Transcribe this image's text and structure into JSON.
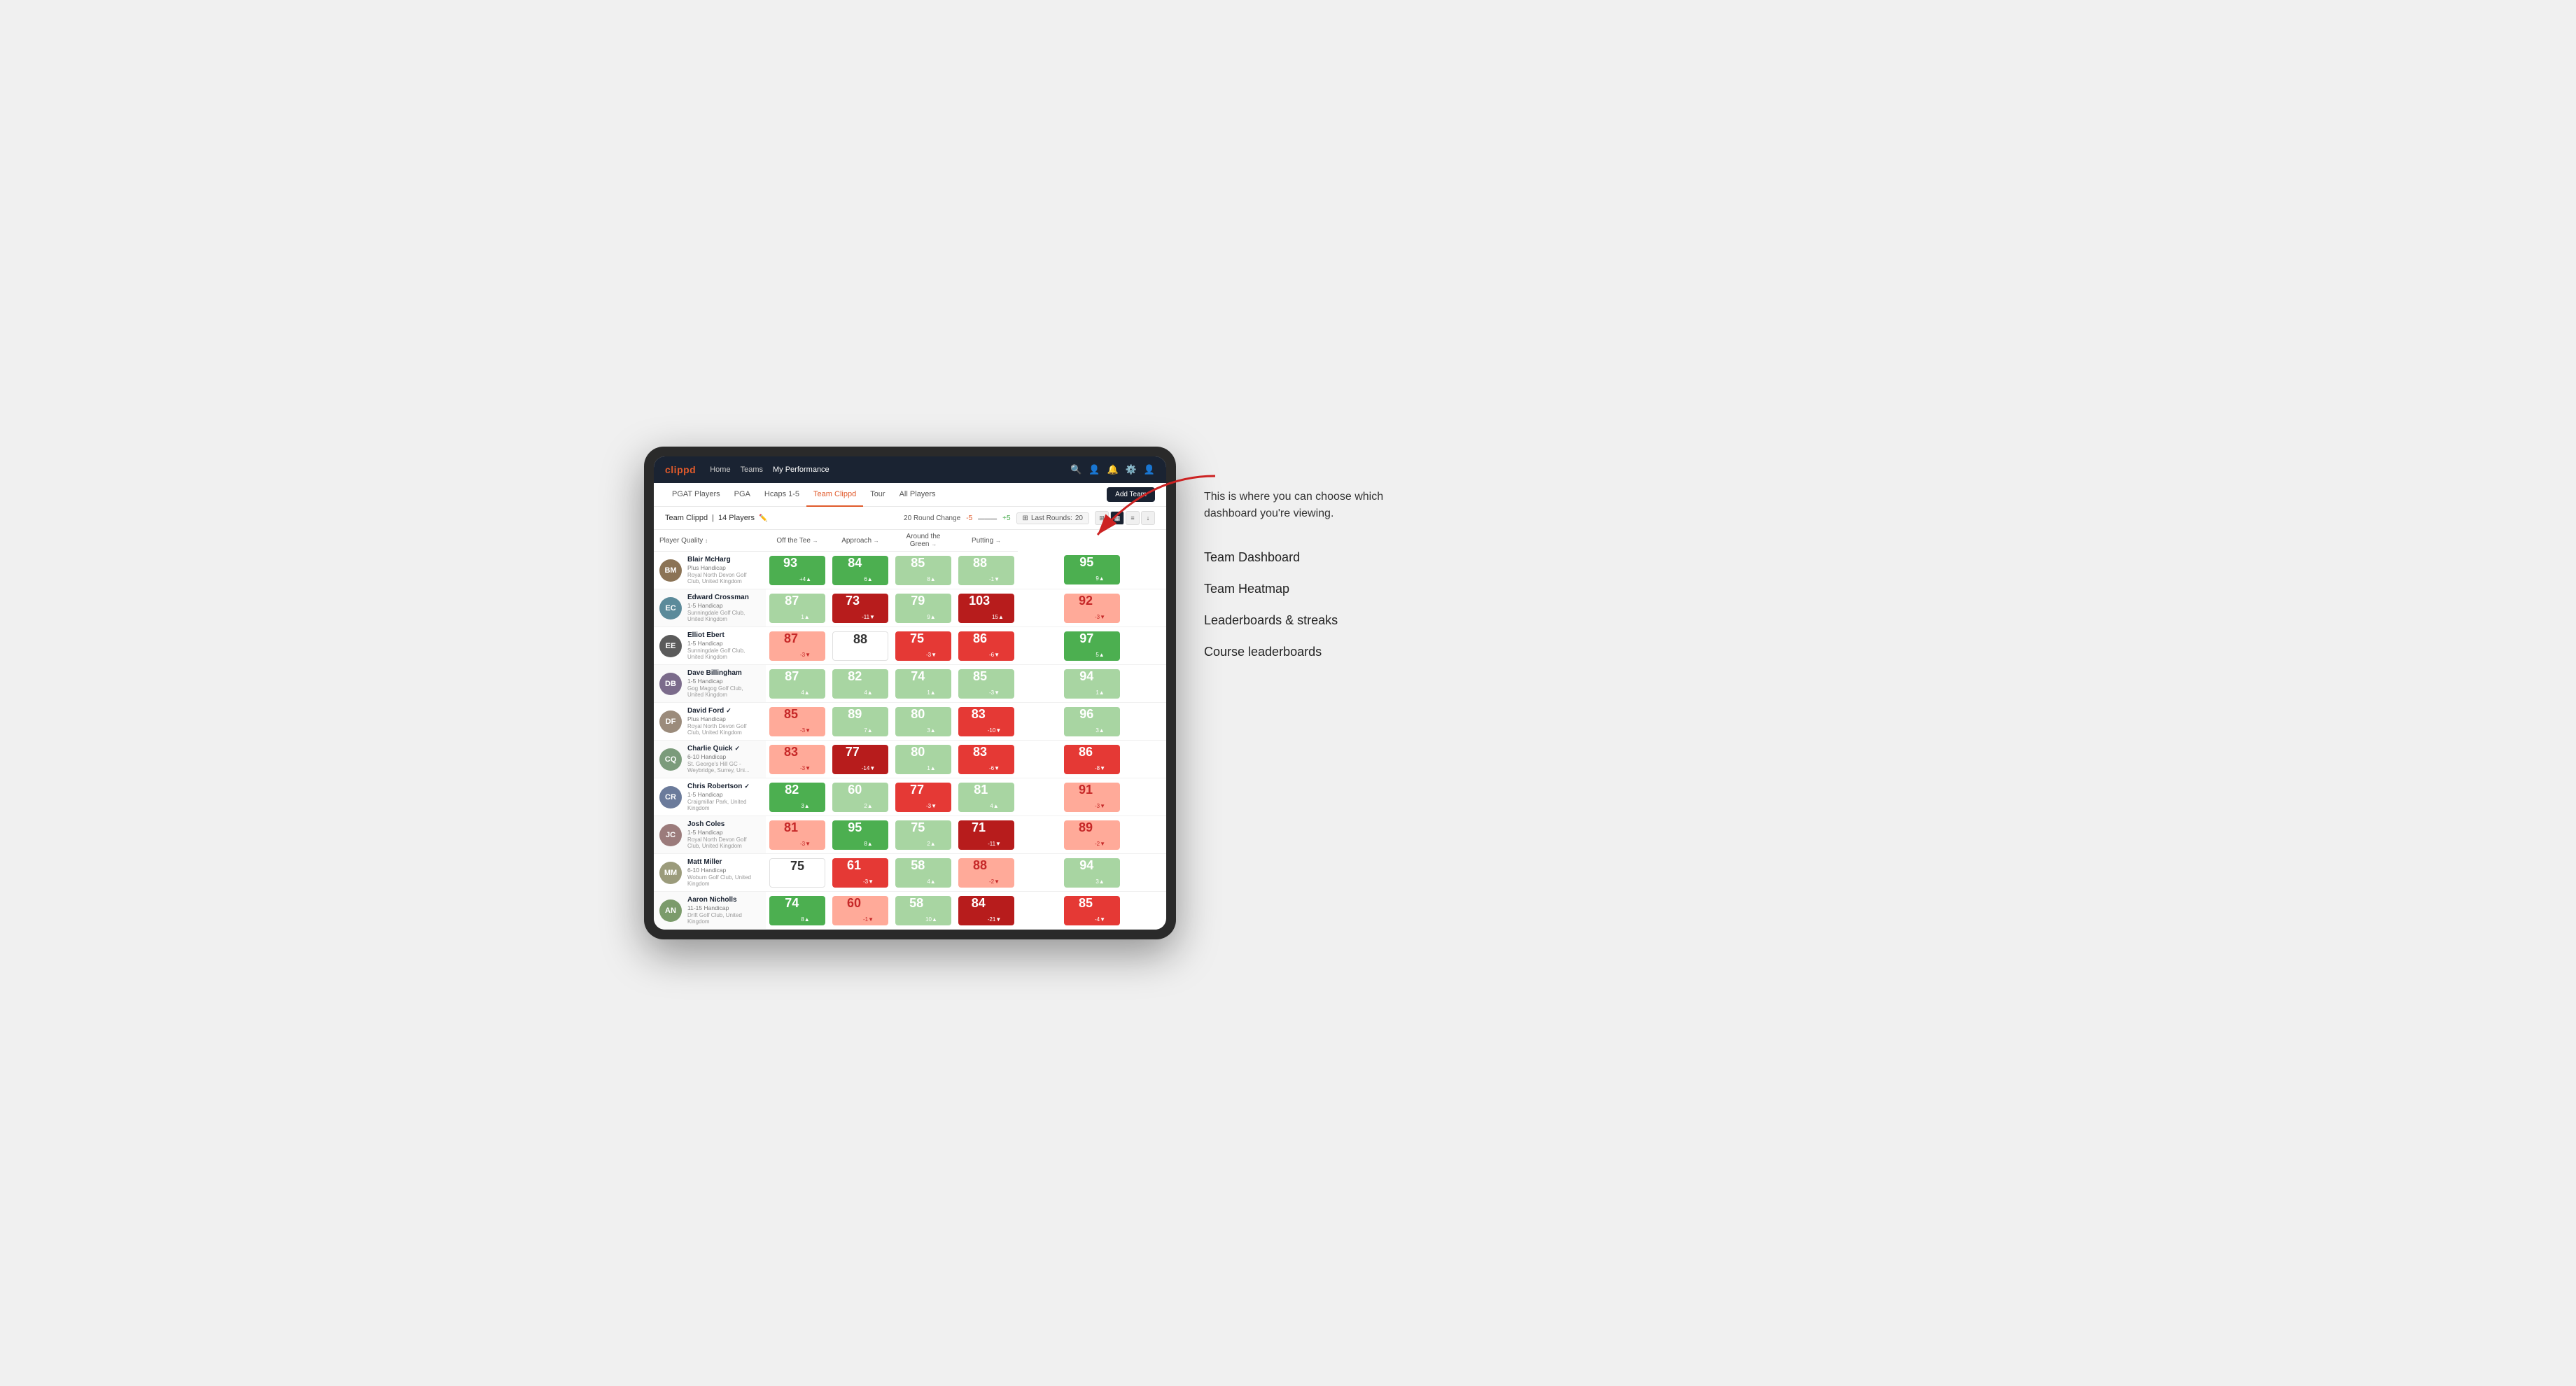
{
  "annotation": {
    "description": "This is where you can choose which dashboard you're viewing.",
    "menu_items": [
      "Team Dashboard",
      "Team Heatmap",
      "Leaderboards & streaks",
      "Course leaderboards"
    ]
  },
  "nav": {
    "logo": "clippd",
    "links": [
      "Home",
      "Teams",
      "My Performance"
    ],
    "active_link": "My Performance"
  },
  "sub_nav": {
    "links": [
      "PGAT Players",
      "PGA",
      "Hcaps 1-5",
      "Team Clippd",
      "Tour",
      "All Players"
    ],
    "active_link": "Team Clippd",
    "add_team_label": "Add Team"
  },
  "team_header": {
    "team_name": "Team Clippd",
    "player_count": "14 Players",
    "round_change_label": "20 Round Change",
    "neg_value": "-5",
    "pos_value": "+5",
    "last_rounds_label": "Last Rounds:",
    "last_rounds_value": "20"
  },
  "table": {
    "columns": [
      {
        "label": "Player Quality",
        "key": "player_quality"
      },
      {
        "label": "Off the Tee",
        "key": "off_tee"
      },
      {
        "label": "Approach",
        "key": "approach"
      },
      {
        "label": "Around the Green",
        "key": "around_green"
      },
      {
        "label": "Putting",
        "key": "putting"
      }
    ],
    "rows": [
      {
        "name": "Blair McHarg",
        "handicap": "Plus Handicap",
        "club": "Royal North Devon Golf Club, United Kingdom",
        "avatar_color": "#7a6a5a",
        "initials": "BM",
        "player_quality": {
          "value": 93,
          "change": "+4",
          "dir": "up",
          "color": "green"
        },
        "off_tee": {
          "value": 84,
          "change": "6",
          "dir": "up",
          "color": "green"
        },
        "approach": {
          "value": 85,
          "change": "8",
          "dir": "up",
          "color": "light-green"
        },
        "around_green": {
          "value": 88,
          "change": "-1",
          "dir": "down",
          "color": "light-green"
        },
        "putting": {
          "value": 95,
          "change": "9",
          "dir": "up",
          "color": "green"
        }
      },
      {
        "name": "Edward Crossman",
        "handicap": "1-5 Handicap",
        "club": "Sunningdale Golf Club, United Kingdom",
        "avatar_color": "#5a7a8a",
        "initials": "EC",
        "player_quality": {
          "value": 87,
          "change": "1",
          "dir": "up",
          "color": "light-green"
        },
        "off_tee": {
          "value": 73,
          "change": "-11",
          "dir": "down",
          "color": "dark-red"
        },
        "approach": {
          "value": 79,
          "change": "9",
          "dir": "up",
          "color": "light-green"
        },
        "around_green": {
          "value": 103,
          "change": "15",
          "dir": "up",
          "color": "dark-red"
        },
        "putting": {
          "value": 92,
          "change": "-3",
          "dir": "down",
          "color": "light-red"
        }
      },
      {
        "name": "Elliot Ebert",
        "handicap": "1-5 Handicap",
        "club": "Sunningdale Golf Club, United Kingdom",
        "avatar_color": "#4a4a4a",
        "initials": "EE",
        "player_quality": {
          "value": 87,
          "change": "-3",
          "dir": "down",
          "color": "light-red"
        },
        "off_tee": {
          "value": 88,
          "change": "",
          "dir": "",
          "color": "white"
        },
        "approach": {
          "value": 75,
          "change": "-3",
          "dir": "down",
          "color": "red"
        },
        "around_green": {
          "value": 86,
          "change": "-6",
          "dir": "down",
          "color": "red"
        },
        "putting": {
          "value": 97,
          "change": "5",
          "dir": "up",
          "color": "green"
        }
      },
      {
        "name": "Dave Billingham",
        "handicap": "1-5 Handicap",
        "club": "Gog Magog Golf Club, United Kingdom",
        "avatar_color": "#6a5a7a",
        "initials": "DB",
        "player_quality": {
          "value": 87,
          "change": "4",
          "dir": "up",
          "color": "light-green"
        },
        "off_tee": {
          "value": 82,
          "change": "4",
          "dir": "up",
          "color": "light-green"
        },
        "approach": {
          "value": 74,
          "change": "1",
          "dir": "up",
          "color": "light-green"
        },
        "around_green": {
          "value": 85,
          "change": "-3",
          "dir": "down",
          "color": "light-green"
        },
        "putting": {
          "value": 94,
          "change": "1",
          "dir": "up",
          "color": "light-green"
        }
      },
      {
        "name": "David Ford",
        "handicap": "Plus Handicap",
        "club": "Royal North Devon Golf Club, United Kingdom",
        "avatar_color": "#8a7a6a",
        "initials": "DF",
        "verified": true,
        "player_quality": {
          "value": 85,
          "change": "-3",
          "dir": "down",
          "color": "light-red"
        },
        "off_tee": {
          "value": 89,
          "change": "7",
          "dir": "up",
          "color": "light-green"
        },
        "approach": {
          "value": 80,
          "change": "3",
          "dir": "up",
          "color": "light-green"
        },
        "around_green": {
          "value": 83,
          "change": "-10",
          "dir": "down",
          "color": "red"
        },
        "putting": {
          "value": 96,
          "change": "3",
          "dir": "up",
          "color": "light-green"
        }
      },
      {
        "name": "Charlie Quick",
        "handicap": "6-10 Handicap",
        "club": "St. George's Hill GC - Weybridge, Surrey, Uni...",
        "avatar_color": "#6a8a6a",
        "initials": "CQ",
        "verified": true,
        "player_quality": {
          "value": 83,
          "change": "-3",
          "dir": "down",
          "color": "light-red"
        },
        "off_tee": {
          "value": 77,
          "change": "-14",
          "dir": "down",
          "color": "dark-red"
        },
        "approach": {
          "value": 80,
          "change": "1",
          "dir": "up",
          "color": "light-green"
        },
        "around_green": {
          "value": 83,
          "change": "-6",
          "dir": "down",
          "color": "red"
        },
        "putting": {
          "value": 86,
          "change": "-8",
          "dir": "down",
          "color": "red"
        }
      },
      {
        "name": "Chris Robertson",
        "handicap": "1-5 Handicap",
        "club": "Craigmillar Park, United Kingdom",
        "avatar_color": "#5a6a8a",
        "initials": "CR",
        "verified": true,
        "player_quality": {
          "value": 82,
          "change": "3",
          "dir": "up",
          "color": "green"
        },
        "off_tee": {
          "value": 60,
          "change": "2",
          "dir": "up",
          "color": "light-green"
        },
        "approach": {
          "value": 77,
          "change": "-3",
          "dir": "down",
          "color": "red"
        },
        "around_green": {
          "value": 81,
          "change": "4",
          "dir": "up",
          "color": "light-green"
        },
        "putting": {
          "value": 91,
          "change": "-3",
          "dir": "down",
          "color": "light-red"
        }
      },
      {
        "name": "Josh Coles",
        "handicap": "1-5 Handicap",
        "club": "Royal North Devon Golf Club, United Kingdom",
        "avatar_color": "#7a5a5a",
        "initials": "JC",
        "player_quality": {
          "value": 81,
          "change": "-3",
          "dir": "down",
          "color": "light-red"
        },
        "off_tee": {
          "value": 95,
          "change": "8",
          "dir": "up",
          "color": "green"
        },
        "approach": {
          "value": 75,
          "change": "2",
          "dir": "up",
          "color": "light-green"
        },
        "around_green": {
          "value": 71,
          "change": "-11",
          "dir": "down",
          "color": "dark-red"
        },
        "putting": {
          "value": 89,
          "change": "-2",
          "dir": "down",
          "color": "light-red"
        }
      },
      {
        "name": "Matt Miller",
        "handicap": "6-10 Handicap",
        "club": "Woburn Golf Club, United Kingdom",
        "avatar_color": "#8a8a6a",
        "initials": "MM",
        "player_quality": {
          "value": 75,
          "change": "",
          "dir": "",
          "color": "white"
        },
        "off_tee": {
          "value": 61,
          "change": "-3",
          "dir": "down",
          "color": "red"
        },
        "approach": {
          "value": 58,
          "change": "4",
          "dir": "up",
          "color": "light-green"
        },
        "around_green": {
          "value": 88,
          "change": "-2",
          "dir": "down",
          "color": "light-red"
        },
        "putting": {
          "value": 94,
          "change": "3",
          "dir": "up",
          "color": "light-green"
        }
      },
      {
        "name": "Aaron Nicholls",
        "handicap": "11-15 Handicap",
        "club": "Drift Golf Club, United Kingdom",
        "avatar_color": "#6a7a5a",
        "initials": "AN",
        "player_quality": {
          "value": 74,
          "change": "8",
          "dir": "up",
          "color": "green"
        },
        "off_tee": {
          "value": 60,
          "change": "-1",
          "dir": "down",
          "color": "light-red"
        },
        "approach": {
          "value": 58,
          "change": "10",
          "dir": "up",
          "color": "light-green"
        },
        "around_green": {
          "value": 84,
          "change": "-21",
          "dir": "down",
          "color": "dark-red"
        },
        "putting": {
          "value": 85,
          "change": "-4",
          "dir": "down",
          "color": "red"
        }
      }
    ]
  },
  "colors": {
    "nav_bg": "#1a2332",
    "accent": "#e05a2b",
    "green_dark": "#2e7d32",
    "green_mid": "#4caf50",
    "green_light": "#a8d5a2",
    "red_dark": "#b71c1c",
    "red_mid": "#e53935",
    "red_light": "#ffcdd2"
  }
}
